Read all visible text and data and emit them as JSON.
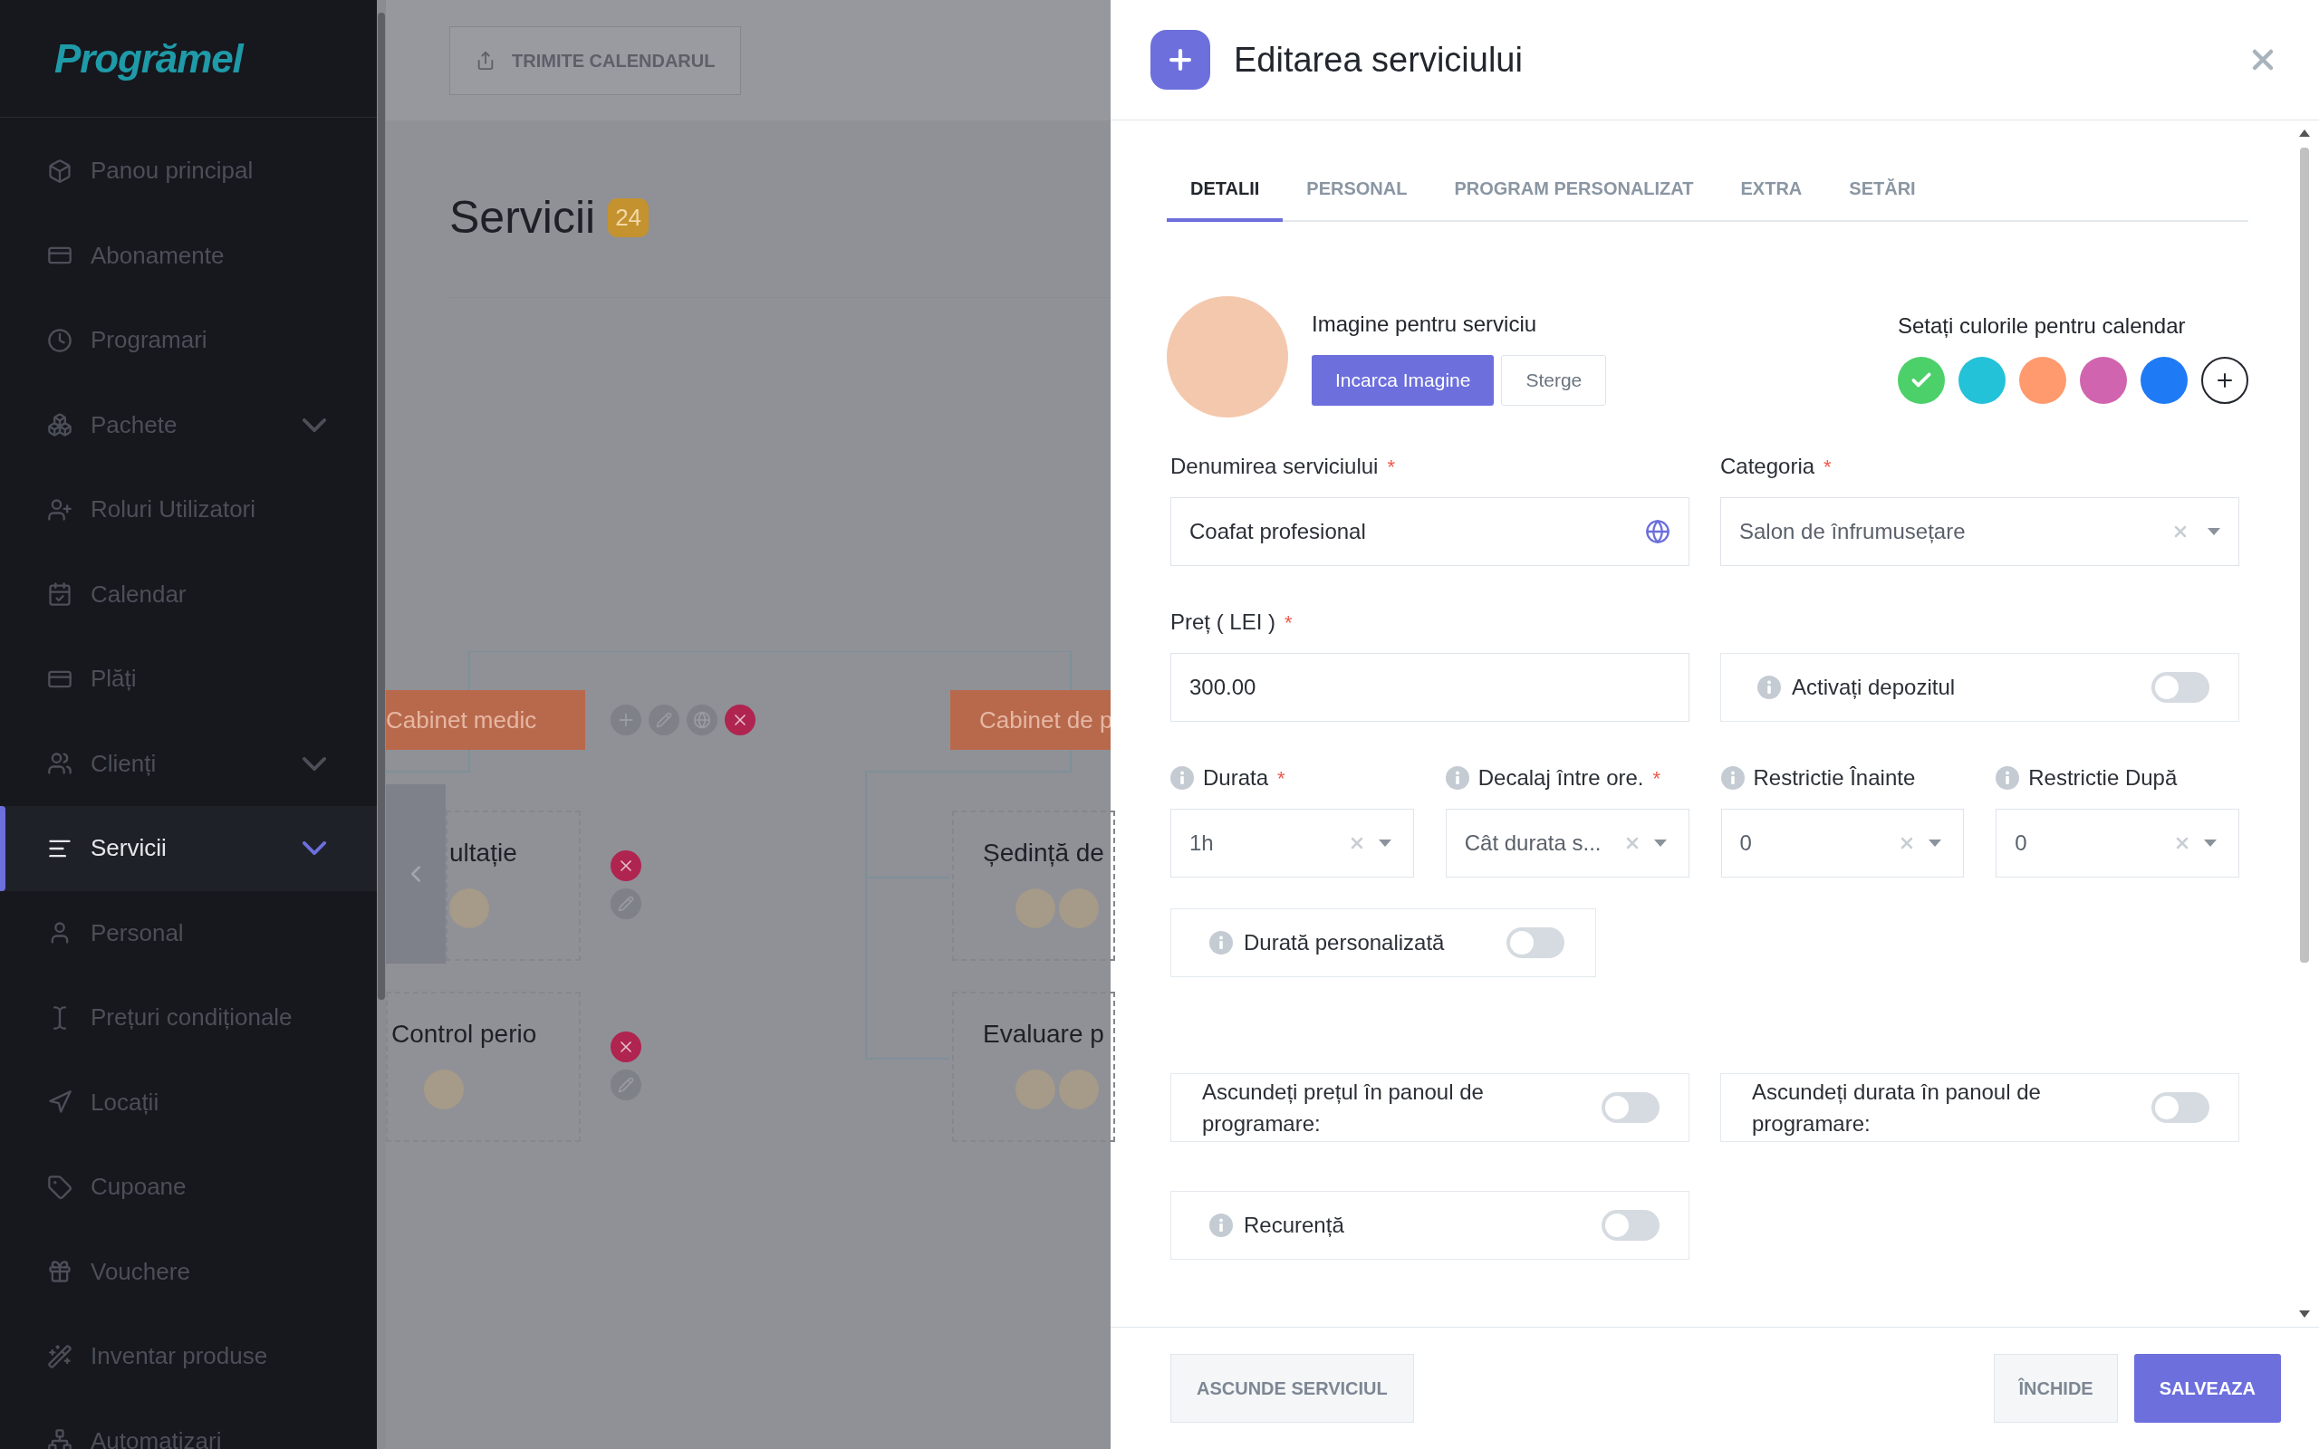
{
  "sidebar": {
    "logo": "Progrămel",
    "items": [
      {
        "label": "Panou principal",
        "selected": false,
        "has_submenu": false
      },
      {
        "label": "Abonamente",
        "selected": false,
        "has_submenu": false
      },
      {
        "label": "Programari",
        "selected": false,
        "has_submenu": false
      },
      {
        "label": "Pachete",
        "selected": false,
        "has_submenu": true
      },
      {
        "label": "Roluri Utilizatori",
        "selected": false,
        "has_submenu": false
      },
      {
        "label": "Calendar",
        "selected": false,
        "has_submenu": false
      },
      {
        "label": "Plăți",
        "selected": false,
        "has_submenu": false
      },
      {
        "label": "Clienți",
        "selected": false,
        "has_submenu": true
      },
      {
        "label": "Servicii",
        "selected": true,
        "has_submenu": true
      },
      {
        "label": "Personal",
        "selected": false,
        "has_submenu": false
      },
      {
        "label": "Prețuri condiționale",
        "selected": false,
        "has_submenu": false
      },
      {
        "label": "Locații",
        "selected": false,
        "has_submenu": false
      },
      {
        "label": "Cupoane",
        "selected": false,
        "has_submenu": false
      },
      {
        "label": "Vouchere",
        "selected": false,
        "has_submenu": false
      },
      {
        "label": "Inventar produse",
        "selected": false,
        "has_submenu": false
      },
      {
        "label": "Automatizari",
        "selected": false,
        "has_submenu": false
      }
    ]
  },
  "page": {
    "share_button": "TRIMITE CALENDARUL",
    "title": "Servicii",
    "count": "24",
    "categories": [
      "Cabinet medic",
      "Cabinet de p"
    ],
    "services": [
      {
        "name": "ultație"
      },
      {
        "name": "Ședință de"
      },
      {
        "name": "Control perio"
      },
      {
        "name": "Evaluare p"
      }
    ]
  },
  "dialog": {
    "title": "Editarea serviciului",
    "required_mark": "*",
    "tabs": [
      {
        "label": "DETALII",
        "selected": true
      },
      {
        "label": "PERSONAL",
        "selected": false
      },
      {
        "label": "PROGRAM PERSONALIZAT",
        "selected": false
      },
      {
        "label": "EXTRA",
        "selected": false
      },
      {
        "label": "SETĂRI",
        "selected": false
      }
    ],
    "image_label": "Imagine pentru serviciu",
    "upload_button": "Incarca Imagine",
    "delete_button": "Sterge",
    "colors_label": "Setați culorile pentru calendar",
    "colors": [
      {
        "color": "#4cd06a",
        "selected": true
      },
      {
        "color": "#23c2d8",
        "selected": false
      },
      {
        "color": "#ff9a6e",
        "selected": false
      },
      {
        "color": "#d164ae",
        "selected": false
      },
      {
        "color": "#1e7af5",
        "selected": false
      }
    ],
    "name_field": {
      "label": "Denumirea serviciului",
      "required": true,
      "value": "Coafat profesional"
    },
    "category_field": {
      "label": "Categoria",
      "required": true,
      "value": "Salon de înfrumusețare"
    },
    "price_field": {
      "label": "Preț ( LEI )",
      "required": true,
      "value": "300.00"
    },
    "deposit": {
      "label": "Activați depozitul",
      "on": false
    },
    "selects": [
      {
        "label": "Durata",
        "required": true,
        "value": "1h"
      },
      {
        "label": "Decalaj între ore.",
        "required": true,
        "value": "Cât durata s..."
      },
      {
        "label": "Restrictie Înainte",
        "required": false,
        "value": "0"
      },
      {
        "label": "Restrictie După",
        "required": false,
        "value": "0"
      }
    ],
    "custom_duration": {
      "label": "Durată personalizată",
      "on": false
    },
    "hide_toggles": [
      {
        "label": "Ascundeți prețul în panoul de programare:",
        "on": false
      },
      {
        "label": "Ascundeți durata în panoul de programare:",
        "on": false
      }
    ],
    "recurrence": {
      "label": "Recurență",
      "on": false
    },
    "hide_service_button": "ASCUNDE SERVICIUL",
    "close_button": "ÎNCHIDE",
    "save_button": "SALVEAZA"
  }
}
